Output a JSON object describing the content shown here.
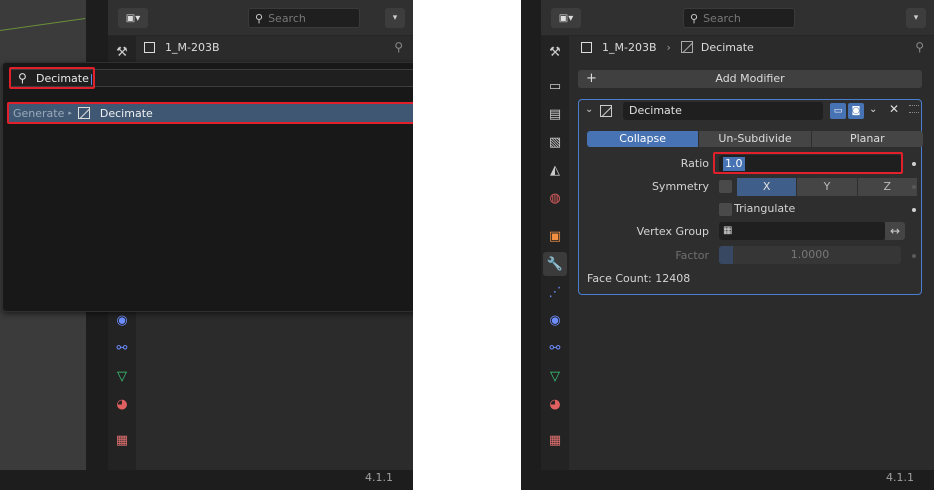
{
  "version": "4.1.1",
  "header": {
    "search_placeholder": "Search",
    "object_name": "1_M-203B"
  },
  "left": {
    "popup": {
      "query": "Decimate",
      "result": {
        "category": "Generate",
        "label": "Decimate"
      }
    }
  },
  "right": {
    "breadcrumb_modifier": "Decimate",
    "add_modifier_label": "Add Modifier",
    "modifier": {
      "name": "Decimate",
      "modes": [
        "Collapse",
        "Un-Subdivide",
        "Planar"
      ],
      "active_mode": "Collapse",
      "ratio_label": "Ratio",
      "ratio_value": "1.0",
      "symmetry_label": "Symmetry",
      "axes": [
        "X",
        "Y",
        "Z"
      ],
      "triangulate_label": "Triangulate",
      "vertex_group_label": "Vertex Group",
      "factor_label": "Factor",
      "factor_value": "1.0000",
      "face_count_text": "Face Count: 12408"
    }
  },
  "colors": {
    "accent": "#4772b3",
    "highlight_box": "#e0202a",
    "panel_bg": "#2b2b2b"
  }
}
